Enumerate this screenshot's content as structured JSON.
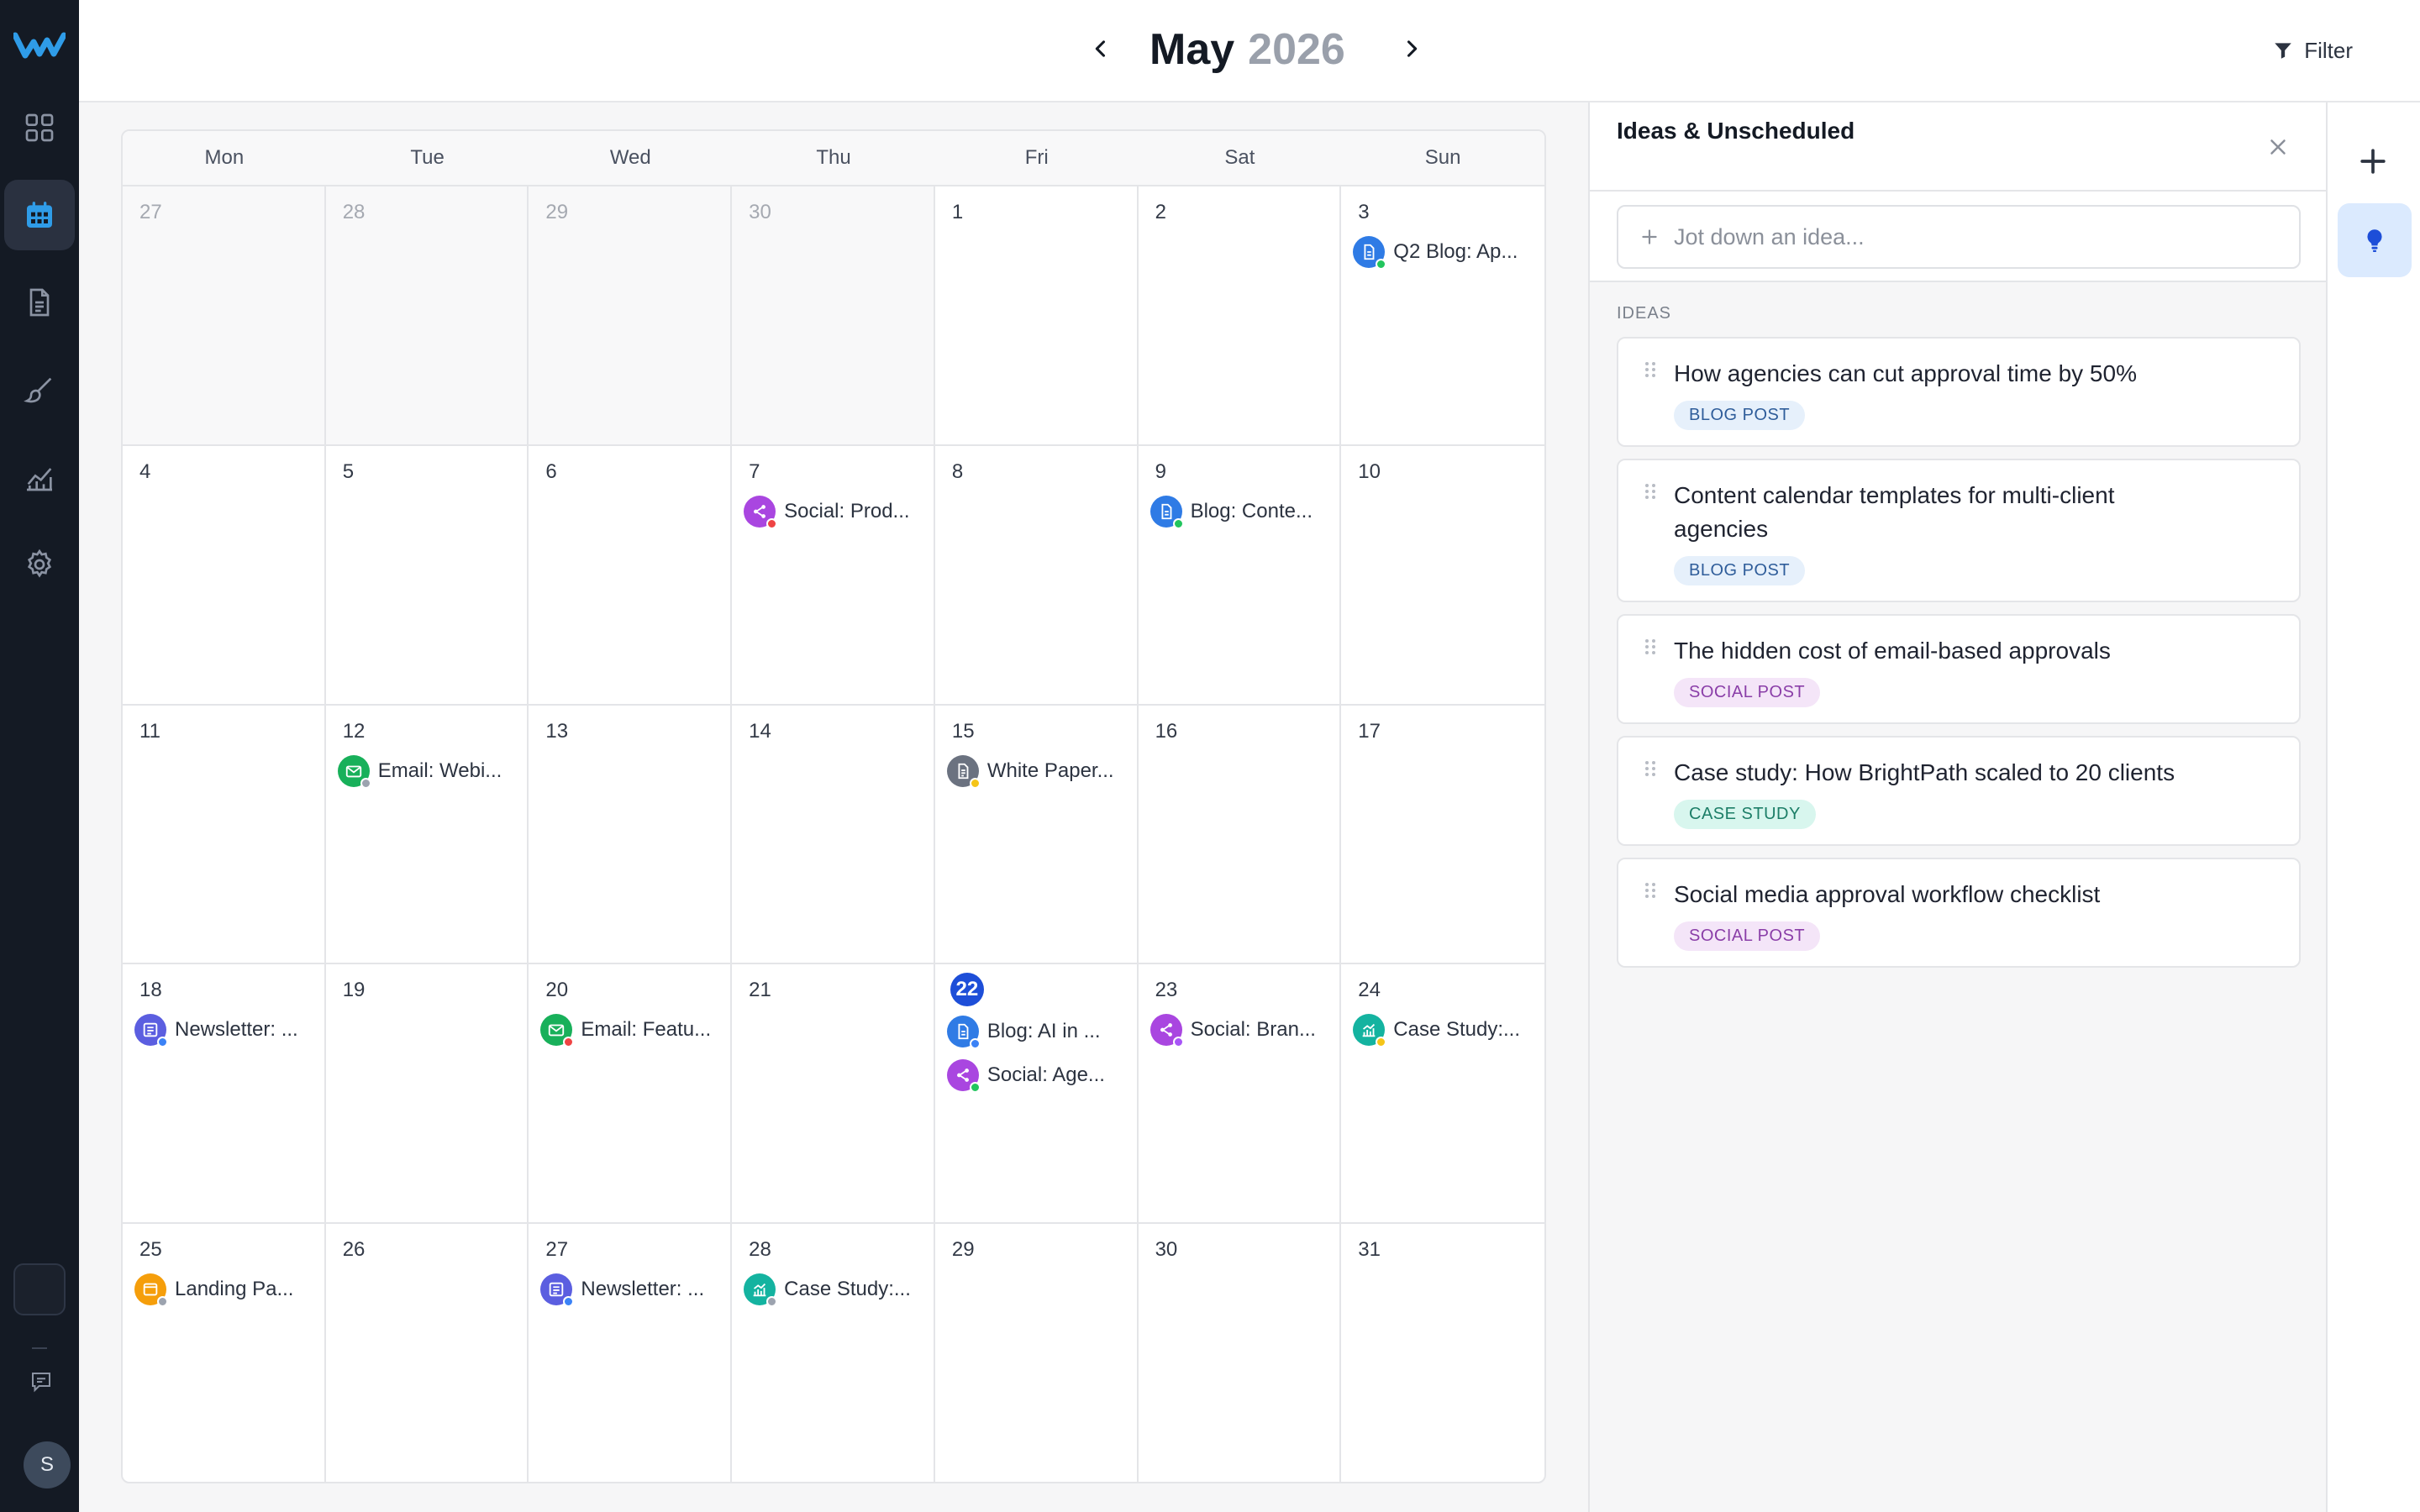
{
  "header": {
    "month": "May",
    "year": "2026",
    "filter_label": "Filter"
  },
  "calendar": {
    "weekdays": [
      "Mon",
      "Tue",
      "Wed",
      "Thu",
      "Fri",
      "Sat",
      "Sun"
    ],
    "days": [
      {
        "num": "27",
        "muted": true,
        "events": []
      },
      {
        "num": "28",
        "muted": true,
        "events": []
      },
      {
        "num": "29",
        "muted": true,
        "events": []
      },
      {
        "num": "30",
        "muted": true,
        "events": []
      },
      {
        "num": "1",
        "events": []
      },
      {
        "num": "2",
        "events": []
      },
      {
        "num": "3",
        "events": [
          {
            "title": "Q2 Blog: Ap...",
            "type": "blog",
            "status": "green"
          }
        ]
      },
      {
        "num": "4",
        "events": []
      },
      {
        "num": "5",
        "events": []
      },
      {
        "num": "6",
        "events": []
      },
      {
        "num": "7",
        "events": [
          {
            "title": "Social: Prod...",
            "type": "social",
            "status": "red"
          }
        ]
      },
      {
        "num": "8",
        "events": []
      },
      {
        "num": "9",
        "events": [
          {
            "title": "Blog: Conte...",
            "type": "blog",
            "status": "green"
          }
        ]
      },
      {
        "num": "10",
        "events": []
      },
      {
        "num": "11",
        "events": []
      },
      {
        "num": "12",
        "events": [
          {
            "title": "Email: Webi...",
            "type": "email",
            "status": "gray"
          }
        ]
      },
      {
        "num": "13",
        "events": []
      },
      {
        "num": "14",
        "events": []
      },
      {
        "num": "15",
        "events": [
          {
            "title": "White Paper...",
            "type": "whitepaper",
            "status": "yellow"
          }
        ]
      },
      {
        "num": "16",
        "events": []
      },
      {
        "num": "17",
        "events": []
      },
      {
        "num": "18",
        "events": [
          {
            "title": "Newsletter: ...",
            "type": "newsletter",
            "status": "blue"
          }
        ]
      },
      {
        "num": "19",
        "events": []
      },
      {
        "num": "20",
        "events": [
          {
            "title": "Email: Featu...",
            "type": "email",
            "status": "red"
          }
        ]
      },
      {
        "num": "21",
        "events": []
      },
      {
        "num": "22",
        "today": true,
        "events": [
          {
            "title": "Blog: AI in ...",
            "type": "blog",
            "status": "blue"
          },
          {
            "title": "Social: Age...",
            "type": "social",
            "status": "green"
          }
        ]
      },
      {
        "num": "23",
        "events": [
          {
            "title": "Social: Bran...",
            "type": "social",
            "status": "purple"
          }
        ]
      },
      {
        "num": "24",
        "events": [
          {
            "title": "Case Study:...",
            "type": "casestudy",
            "status": "yellow"
          }
        ]
      },
      {
        "num": "25",
        "events": [
          {
            "title": "Landing Pa...",
            "type": "landing",
            "status": "gray"
          }
        ]
      },
      {
        "num": "26",
        "events": []
      },
      {
        "num": "27",
        "events": [
          {
            "title": "Newsletter: ...",
            "type": "newsletter",
            "status": "blue"
          }
        ]
      },
      {
        "num": "28",
        "events": [
          {
            "title": "Case Study:...",
            "type": "casestudy",
            "status": "gray"
          }
        ]
      },
      {
        "num": "29",
        "events": []
      },
      {
        "num": "30",
        "events": []
      },
      {
        "num": "31",
        "events": []
      }
    ]
  },
  "type_colors": {
    "blog": "#2f7be5",
    "social": "#a946e0",
    "email": "#18b05a",
    "whitepaper": "#6b7280",
    "newsletter": "#5b5ee0",
    "casestudy": "#14b3a0",
    "landing": "#f59e0b"
  },
  "status_colors": {
    "green": "#22c55e",
    "red": "#ef4444",
    "gray": "#9ca3af",
    "yellow": "#f5c518",
    "blue": "#3b82f6",
    "purple": "#a855f7"
  },
  "ideas_panel": {
    "title": "Ideas & Unscheduled",
    "input_placeholder": "Jot down an idea...",
    "section_label": "IDEAS",
    "items": [
      {
        "text": "How agencies can cut approval time by 50%",
        "tag": "BLOG POST",
        "tag_kind": "blog"
      },
      {
        "text": "Content calendar templates for multi-client agencies",
        "tag": "BLOG POST",
        "tag_kind": "blog"
      },
      {
        "text": "The hidden cost of email-based approvals",
        "tag": "SOCIAL POST",
        "tag_kind": "social"
      },
      {
        "text": "Case study: How BrightPath scaled to 20 clients",
        "tag": "CASE STUDY",
        "tag_kind": "case"
      },
      {
        "text": "Social media approval workflow checklist",
        "tag": "SOCIAL POST",
        "tag_kind": "social"
      }
    ]
  },
  "sidebar": {
    "avatar_initial": "S",
    "items": [
      {
        "icon": "dashboard-grid-icon"
      },
      {
        "icon": "calendar-icon",
        "active": true
      },
      {
        "icon": "document-icon"
      },
      {
        "icon": "brush-icon"
      },
      {
        "icon": "analytics-icon"
      },
      {
        "icon": "settings-gear-icon"
      }
    ]
  }
}
